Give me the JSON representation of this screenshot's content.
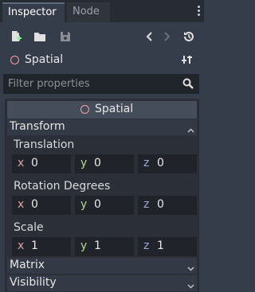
{
  "tabs": {
    "inspector": "Inspector",
    "node": "Node"
  },
  "object": {
    "name": "Spatial"
  },
  "filter": {
    "placeholder": "Filter properties"
  },
  "section": {
    "title": "Spatial"
  },
  "categories": {
    "transform": "Transform",
    "matrix": "Matrix",
    "visibility": "Visibility"
  },
  "properties": {
    "translation": {
      "label": "Translation",
      "x": "0",
      "y": "0",
      "z": "0"
    },
    "rotation": {
      "label": "Rotation Degrees",
      "x": "0",
      "y": "0",
      "z": "0"
    },
    "scale": {
      "label": "Scale",
      "x": "1",
      "y": "1",
      "z": "1"
    }
  },
  "axes": {
    "x": "x",
    "y": "y",
    "z": "z"
  },
  "colors": {
    "background": "#363d4a",
    "node_icon": "#fc9c9c",
    "axis_x": "#d9a6a6",
    "axis_y": "#b7d692",
    "axis_z": "#9fa9d6"
  }
}
